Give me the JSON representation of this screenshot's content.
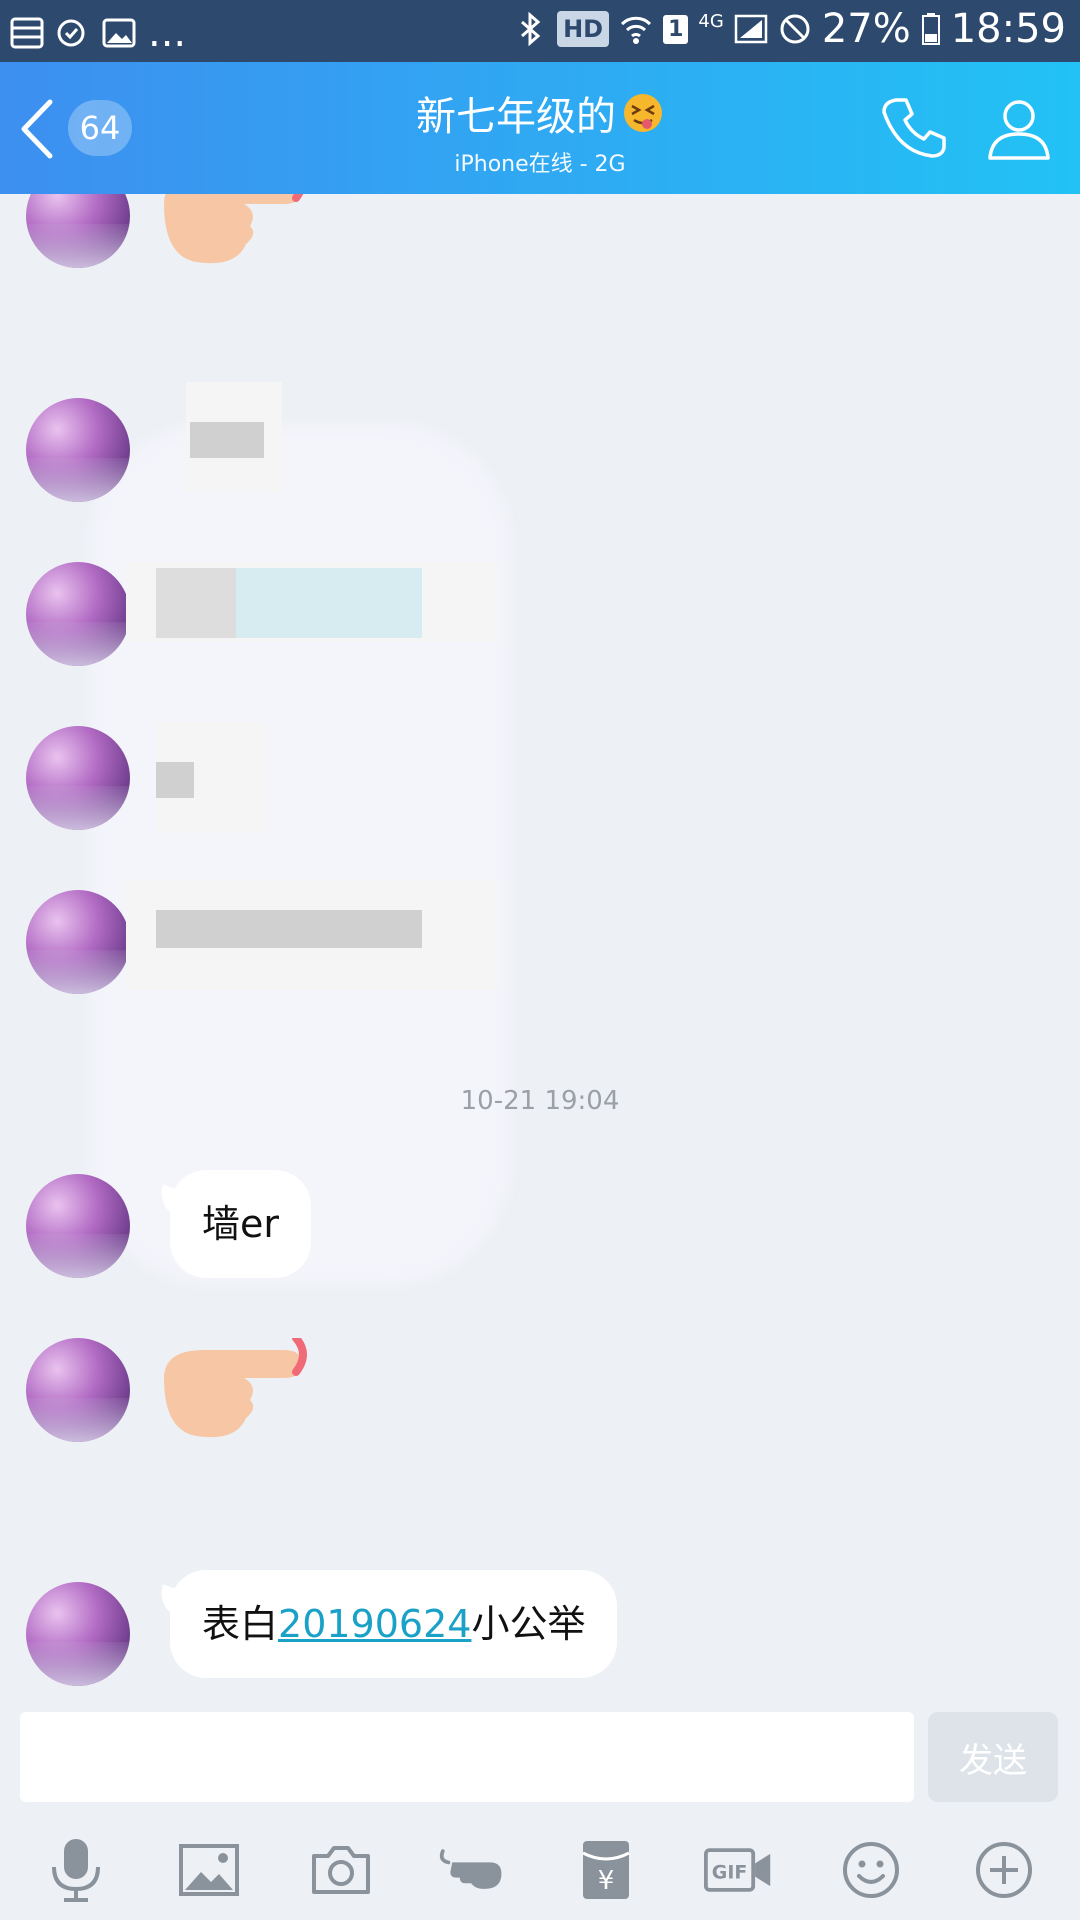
{
  "status_bar": {
    "ellipsis": "...",
    "hd": "HD",
    "sim": "1",
    "network": "4G",
    "battery": "27%",
    "time": "18:59"
  },
  "header": {
    "unread_count": "64",
    "title": "新七年级的",
    "subtitle": "iPhone在线 - 2G"
  },
  "messages": {
    "timestamp": "10-21 19:04",
    "msg1_text": "墙er",
    "msg3_prefix": "表白",
    "msg3_link": "20190624",
    "msg3_suffix": "小公举"
  },
  "input": {
    "value": "",
    "send_label": "发送"
  },
  "toolbar": {
    "icons": [
      "microphone-icon",
      "image-icon",
      "camera-icon",
      "poke-icon",
      "red-packet-icon",
      "gif-icon",
      "emoji-icon",
      "plus-icon"
    ]
  },
  "colors": {
    "header_start": "#3d8ff0",
    "header_end": "#22c2f5",
    "link": "#1aa1c8",
    "chat_bg": "#edf1f5"
  }
}
